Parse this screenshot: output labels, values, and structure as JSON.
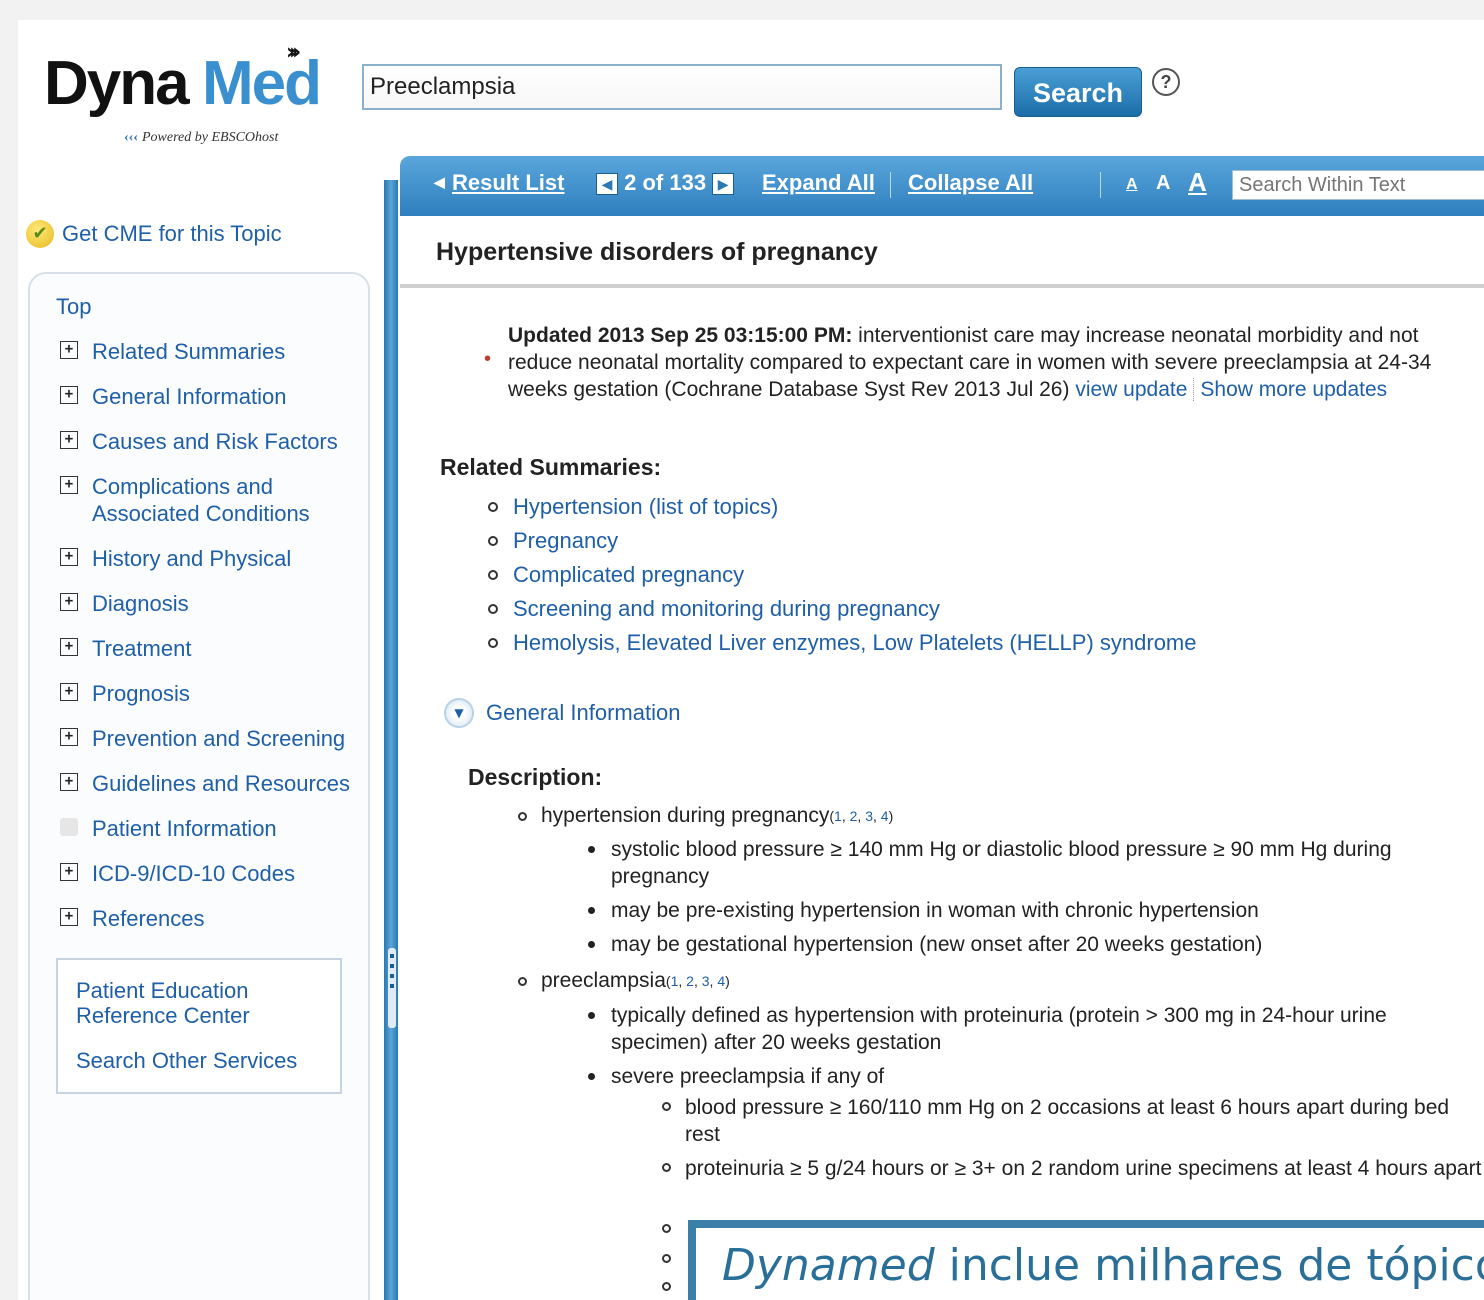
{
  "header": {
    "logo_dyna": "Dyna",
    "logo_med": "Med",
    "logo_sub": "Powered by EBSCOhost",
    "search_value": "Preeclampsia",
    "search_button": "Search",
    "help_icon": "?"
  },
  "sidebar": {
    "cme_label": "Get CME for this Topic",
    "top_label": "Top",
    "items": [
      {
        "label": "Related Summaries",
        "icon": "plus-box"
      },
      {
        "label": "General Information",
        "icon": "plus-box"
      },
      {
        "label": "Causes and Risk Factors",
        "icon": "plus-box"
      },
      {
        "label": "Complications and Associated Conditions",
        "icon": "plus-box"
      },
      {
        "label": "History and Physical",
        "icon": "plus-box"
      },
      {
        "label": "Diagnosis",
        "icon": "plus-box"
      },
      {
        "label": "Treatment",
        "icon": "plus-box"
      },
      {
        "label": "Prognosis",
        "icon": "plus-box"
      },
      {
        "label": "Prevention and Screening",
        "icon": "plus-box"
      },
      {
        "label": "Guidelines and Resources",
        "icon": "plus-box"
      },
      {
        "label": "Patient Information",
        "icon": "blank-box"
      },
      {
        "label": "ICD-9/ICD-10 Codes",
        "icon": "plus-box"
      },
      {
        "label": "References",
        "icon": "plus-box"
      }
    ],
    "patient_education": "Patient Education Reference Center",
    "search_other": "Search Other Services"
  },
  "toolbar": {
    "result_list": "Result List",
    "position": "2 of 133",
    "expand_all": "Expand All",
    "collapse_all": "Collapse All",
    "font_small": "A",
    "font_medium": "A",
    "font_large": "A",
    "within_placeholder": "Search Within Text"
  },
  "content": {
    "title": "Hypertensive disorders of pregnancy",
    "update_bold": "Updated 2013 Sep 25 03:15:00 PM:",
    "update_text": " interventionist care may increase neonatal morbidity and not reduce neonatal mortality compared to expectant care in women with severe preeclampsia at 24-34 weeks gestation (Cochrane Database Syst Rev 2013 Jul 26) ",
    "view_update": "view update",
    "show_more": "Show more updates",
    "related_heading": "Related Summaries:",
    "related": [
      "Hypertension (list of topics)",
      "Pregnancy",
      "Complicated pregnancy",
      "Screening and monitoring during pregnancy",
      "Hemolysis, Elevated Liver enzymes, Low Platelets (HELLP) syndrome"
    ],
    "general_info": "General Information",
    "description_heading": "Description:",
    "desc1": "hypertension during pregnancy",
    "desc2": "preeclampsia",
    "refs_open": "(",
    "refs_close": ")",
    "refs": [
      "1",
      "2",
      "3",
      "4"
    ],
    "sub1": [
      "systolic blood pressure ≥ 140 mm Hg or diastolic blood pressure ≥ 90 mm Hg during pregnancy",
      "may be pre-existing hypertension in woman with chronic hypertension",
      "may be gestational hypertension (new onset after 20 weeks gestation)"
    ],
    "sub2": [
      "typically defined as hypertension with proteinuria (protein > 300 mg in 24-hour urine specimen) after 20 weeks gestation",
      "severe preeclampsia if any of"
    ],
    "sub3": [
      "blood pressure ≥ 160/110 mm Hg on 2 occasions at least 6 hours apart during bed rest",
      "proteinuria ≥ 5 g/24 hours or ≥ 3+ on 2 random urine specimens at least 4 hours apart"
    ]
  },
  "caption": {
    "italic": "Dynamed",
    "text": " inclue milhares de tópicos"
  }
}
